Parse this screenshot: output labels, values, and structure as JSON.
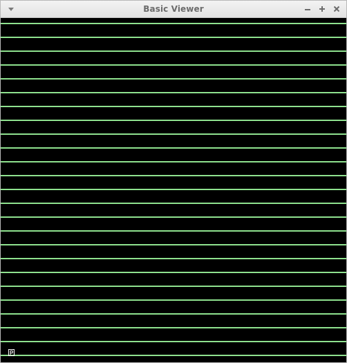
{
  "window": {
    "title": "Basic Viewer"
  },
  "titlebar_buttons": {
    "menu_icon": "chevron-down-icon",
    "minimize_icon": "minimize-icon",
    "maximize_icon": "maximize-icon",
    "close_icon": "close-icon"
  },
  "viewport": {
    "background_color": "#000000",
    "line_color": "#8fe28f",
    "line_count": 25,
    "corner_marker_icon": "axes-marker-icon"
  }
}
